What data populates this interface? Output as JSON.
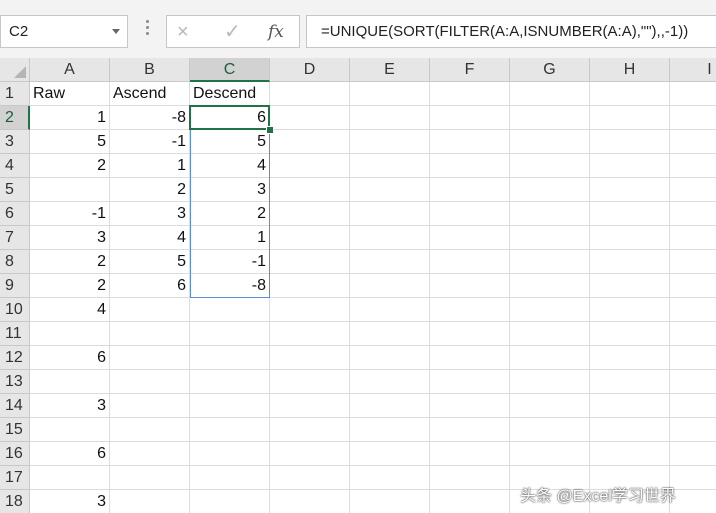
{
  "formula_bar": {
    "name_box": "C2",
    "cancel_icon": "×",
    "enter_icon": "✓",
    "fx_icon": "fx",
    "formula": "=UNIQUE(SORT(FILTER(A:A,ISNUMBER(A:A),\"\"),,-1))"
  },
  "sheet": {
    "columns": [
      "A",
      "B",
      "C",
      "D",
      "E",
      "F",
      "G",
      "H",
      "I"
    ],
    "rows": [
      "1",
      "2",
      "3",
      "4",
      "5",
      "6",
      "7",
      "8",
      "9",
      "10",
      "11",
      "12",
      "13",
      "14",
      "15",
      "16",
      "17",
      "18"
    ],
    "selected_column": "C",
    "selected_row": "2",
    "cells": [
      [
        "Raw",
        "Ascend",
        "Descend"
      ],
      [
        "1",
        "-8",
        "6"
      ],
      [
        "5",
        "-1",
        "5"
      ],
      [
        "2",
        "1",
        "4"
      ],
      [
        "",
        "2",
        "3"
      ],
      [
        "-1",
        "3",
        "2"
      ],
      [
        "3",
        "4",
        "1"
      ],
      [
        "2",
        "5",
        "-1"
      ],
      [
        "2",
        "6",
        "-8"
      ],
      [
        "4",
        "",
        ""
      ],
      [
        "",
        "",
        ""
      ],
      [
        "6",
        "",
        ""
      ],
      [
        "",
        "",
        ""
      ],
      [
        "3",
        "",
        ""
      ],
      [
        "",
        "",
        ""
      ],
      [
        "6",
        "",
        ""
      ],
      [
        "",
        "",
        ""
      ],
      [
        "3",
        "",
        ""
      ]
    ]
  },
  "watermark": "头条 @Excel学习世界"
}
